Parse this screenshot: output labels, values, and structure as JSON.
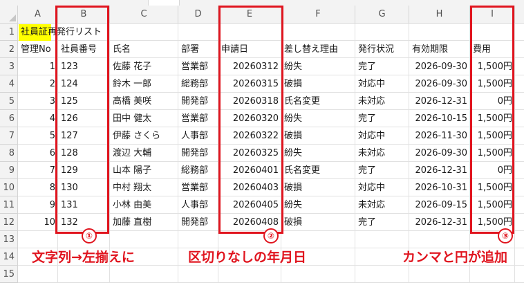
{
  "sheet": {
    "columns": [
      "A",
      "B",
      "C",
      "D",
      "E",
      "F",
      "G",
      "H",
      "I"
    ],
    "rows": [
      "1",
      "2",
      "3",
      "4",
      "5",
      "6",
      "7",
      "8",
      "9",
      "10",
      "11",
      "12",
      "13",
      "14",
      "15"
    ],
    "title": "社員証再発行リスト",
    "headers": [
      "管理No",
      "社員番号",
      "氏名",
      "部署",
      "申請日",
      "差し替え理由",
      "発行状況",
      "有効期限",
      "費用"
    ],
    "data": [
      [
        "1",
        "123",
        "佐藤 花子",
        "営業部",
        "20260312",
        "紛失",
        "完了",
        "2026-09-30",
        "1,500円"
      ],
      [
        "2",
        "124",
        "鈴木 一郎",
        "総務部",
        "20260315",
        "破損",
        "対応中",
        "2026-09-30",
        "1,500円"
      ],
      [
        "3",
        "125",
        "高橋 美咲",
        "開発部",
        "20260318",
        "氏名変更",
        "未対応",
        "2026-12-31",
        "0円"
      ],
      [
        "4",
        "126",
        "田中 健太",
        "営業部",
        "20260320",
        "紛失",
        "完了",
        "2026-10-15",
        "1,500円"
      ],
      [
        "5",
        "127",
        "伊藤 さくら",
        "人事部",
        "20260322",
        "破損",
        "対応中",
        "2026-11-30",
        "1,500円"
      ],
      [
        "6",
        "128",
        "渡辺 大輔",
        "開発部",
        "20260325",
        "紛失",
        "未対応",
        "2026-09-30",
        "1,500円"
      ],
      [
        "7",
        "129",
        "山本 陽子",
        "総務部",
        "20260401",
        "氏名変更",
        "完了",
        "2026-12-31",
        "0円"
      ],
      [
        "8",
        "130",
        "中村 翔太",
        "営業部",
        "20260403",
        "破損",
        "対応中",
        "2026-10-31",
        "1,500円"
      ],
      [
        "9",
        "131",
        "小林 由美",
        "人事部",
        "20260405",
        "紛失",
        "未対応",
        "2026-09-15",
        "1,500円"
      ],
      [
        "10",
        "132",
        "加藤 直樹",
        "開発部",
        "20260408",
        "破損",
        "完了",
        "2026-12-31",
        "1,500円"
      ]
    ]
  },
  "annotations": {
    "badges": [
      "①",
      "②",
      "③"
    ],
    "labels": [
      "文字列→左揃えに",
      "区切りなしの年月日",
      "カンマと円が追加"
    ],
    "color": "#e0141e"
  },
  "colors": {
    "title_highlight": "#ffff00",
    "header_bg": "#f3f3f3",
    "gridline": "#e1e1e1"
  }
}
